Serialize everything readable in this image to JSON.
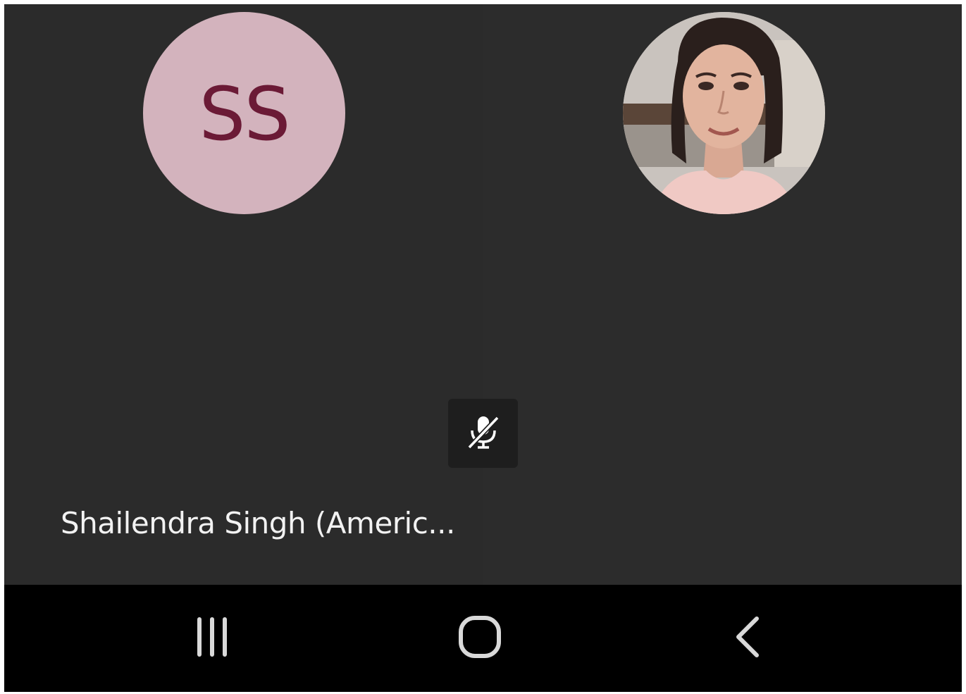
{
  "participants": [
    {
      "initials": "SS",
      "name": "Shailendra Singh (Americ...",
      "avatar_bg": "#d3b3bd",
      "initials_color": "#6b1a36",
      "muted": true
    },
    {
      "avatar": "photo",
      "muted": false
    }
  ],
  "icons": {
    "mute": "microphone-off-icon",
    "recents": "recent-apps-icon",
    "home": "home-icon",
    "back": "back-icon"
  },
  "colors": {
    "tile_bg": "#2b2b2b",
    "navbar_bg": "#000000",
    "nav_icon": "#d9d9d9"
  }
}
